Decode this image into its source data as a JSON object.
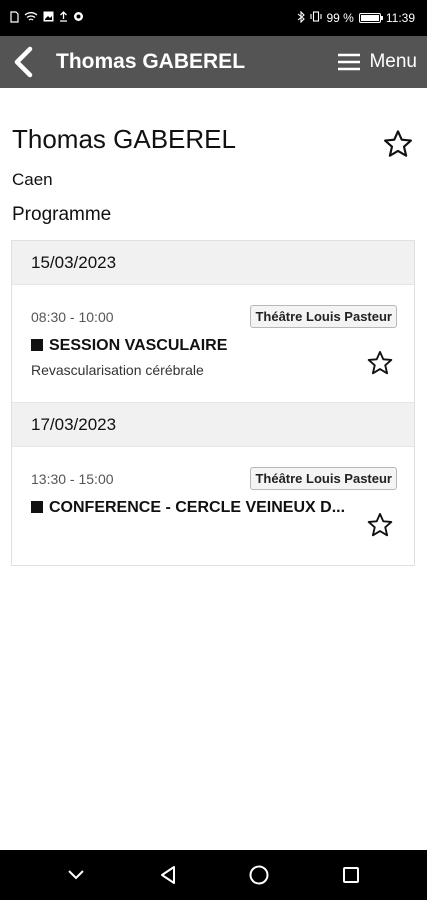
{
  "status_bar": {
    "battery_text": "99 %",
    "time": "11:39",
    "battery_level": 0.99
  },
  "header": {
    "title": "Thomas GABEREL",
    "menu_label": "Menu"
  },
  "person": {
    "name": "Thomas GABEREL",
    "city": "Caen"
  },
  "programme": {
    "title": "Programme",
    "days": [
      {
        "date": "15/03/2023",
        "sessions": [
          {
            "time": "08:30 - 10:00",
            "room": "Théâtre Louis Pasteur",
            "title": "SESSION VASCULAIRE",
            "subtitle": "Revascularisation cérébrale"
          }
        ]
      },
      {
        "date": "17/03/2023",
        "sessions": [
          {
            "time": "13:30 - 15:00",
            "room": "Théâtre Louis Pasteur",
            "title": "CONFERENCE - CERCLE VEINEUX D...",
            "subtitle": ""
          }
        ]
      }
    ]
  },
  "icons": {
    "back": "back-arrow-icon",
    "menu": "hamburger-icon",
    "favorite": "star-outline-icon"
  },
  "colors": {
    "header_bg": "#545454",
    "date_header_bg": "#f1f1f1",
    "system_bar_bg": "#000000"
  }
}
